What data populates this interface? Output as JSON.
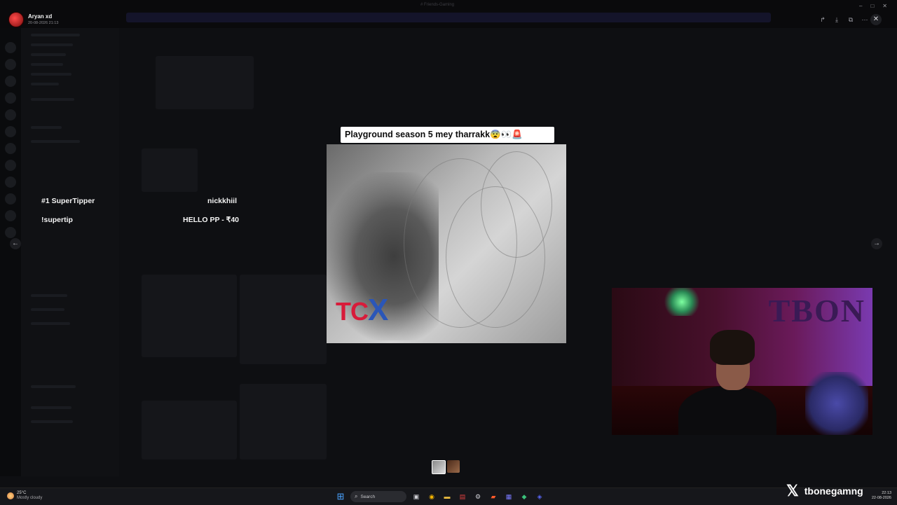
{
  "viewer": {
    "user_name": "Aryan xd",
    "post_date": "20-08-2026 21:13",
    "window_title": "# Friends-Gaming"
  },
  "overlay": {
    "supertipper_label": "#1 SuperTipper",
    "supertipper_name": "nickkhiil",
    "supertip_command": "!supertip",
    "last_tip": "HELLO PP - ₹40"
  },
  "media": {
    "caption": "Playground season 5 mey tharrakk😨👀🚨",
    "watermark": "TCX"
  },
  "webcam": {
    "sign_text": "TBON"
  },
  "stream_brand": {
    "handle": "tbonegamng"
  },
  "taskbar": {
    "temperature": "25°C",
    "condition": "Mostly cloudy",
    "search_placeholder": "Search",
    "time": "22:13",
    "date": "22-08-2026",
    "lang": "IN"
  },
  "icons": {
    "prev": "chevron-left",
    "next": "chevron-right",
    "close": "close",
    "share": "share",
    "download": "download",
    "open": "external-link",
    "more": "more-horizontal"
  }
}
